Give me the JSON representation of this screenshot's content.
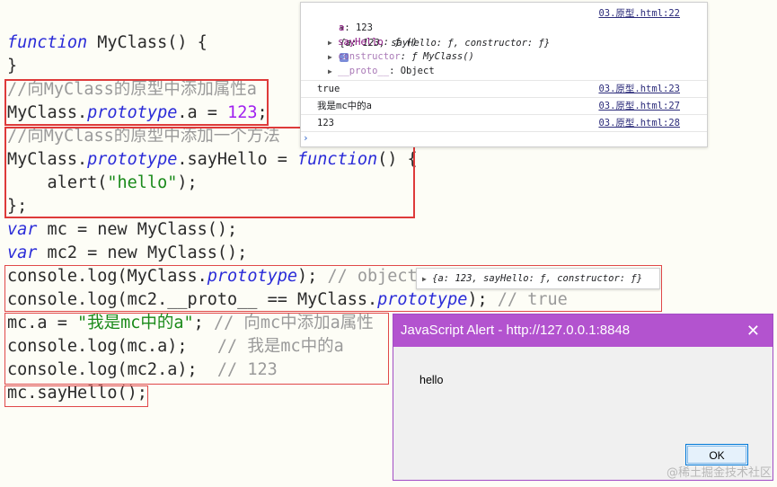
{
  "code": {
    "l1_kw": "function",
    "l1_rest": " MyClass() {",
    "l2": "}",
    "l3_comment": "//向MyClass的原型中添加属性a",
    "l4_a": "MyClass.",
    "l4_prop": "prototype",
    "l4_b": ".a = ",
    "l4_num": "123",
    "l4_c": ";",
    "l5_comment": "//向MyClass的原型中添加一个方法",
    "l6_a": "MyClass.",
    "l6_prop": "prototype",
    "l6_b": ".sayHello = ",
    "l6_kw": "function",
    "l6_c": "() {",
    "l7_a": "    alert(",
    "l7_str": "\"hello\"",
    "l7_b": ");",
    "l8": "};",
    "l9_kw": "var",
    "l9_rest": " mc = new MyClass();",
    "l10_kw": "var",
    "l10_rest": " mc2 = new MyClass();",
    "l11_a": "console.log(MyClass.",
    "l11_prop": "prototype",
    "l11_b": "); ",
    "l11_comment": "// object",
    "l12_a": "console.log(mc2.__proto__ == MyClass.",
    "l12_prop": "prototype",
    "l12_b": "); ",
    "l12_comment": "// true",
    "l13_a": "mc.a = ",
    "l13_str": "\"我是mc中的a\"",
    "l13_b": "; ",
    "l13_comment": "// 向mc中添加a属性",
    "l14_a": "console.log(mc.a);   ",
    "l14_comment": "// 我是mc中的a",
    "l15_a": "console.log(mc2.a);  ",
    "l15_comment": "// 123",
    "l16": "mc.sayHello();"
  },
  "console": {
    "obj_summary": "{a: 123, sayHello: ƒ, constructor: ƒ}",
    "src1": "03.原型.html:22",
    "prop_a_key": "a",
    "prop_a_val": ": 123",
    "prop_say_key": "sayHello",
    "prop_say_val": ": ƒ ()",
    "prop_ctor_key": "constructor",
    "prop_ctor_val": ": ƒ MyClass()",
    "prop_proto_key": "__proto__",
    "prop_proto_val": ": Object",
    "out2": "true",
    "src2": "03.原型.html:23",
    "out3": "我是mc中的a",
    "src3": "03.原型.html:27",
    "out4": "123",
    "src4": "03.原型.html:28",
    "prompt": "›",
    "info_badge": "i"
  },
  "tooltip": {
    "text": "{a: 123, sayHello: ƒ, constructor: ƒ}"
  },
  "alert": {
    "title": "JavaScript Alert - http://127.0.0.1:8848",
    "message": "hello",
    "ok_label": "OK",
    "close_glyph": "✕"
  },
  "watermark": "@稀土掘金技术社区",
  "colors": {
    "keyword": "#2a2bd8",
    "string": "#1a8a1a",
    "number": "#a020f0",
    "comment": "#9a9a9a",
    "box": "#de3a3a",
    "alert_title": "#b353cf"
  }
}
